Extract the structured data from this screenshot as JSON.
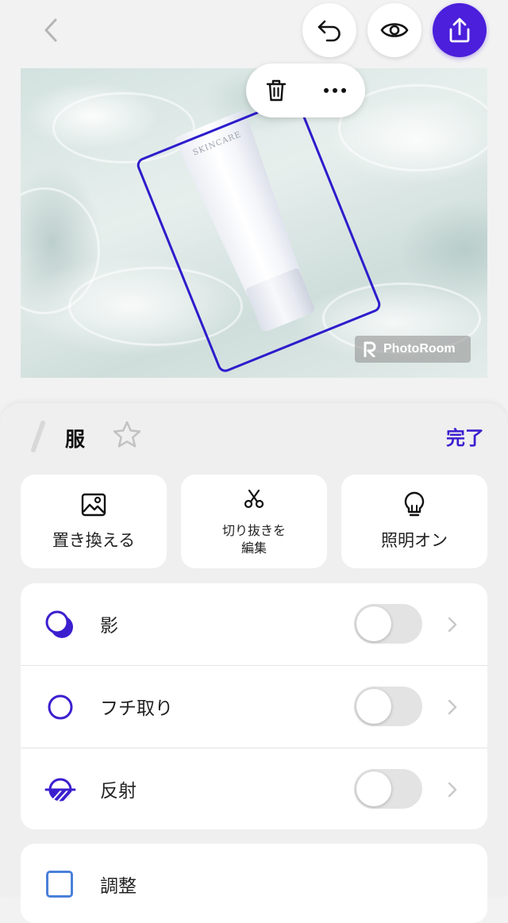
{
  "topbar": {
    "back_icon": "chevron-left-icon",
    "undo_icon": "undo-icon",
    "preview_icon": "eye-icon",
    "share_icon": "share-icon",
    "accent_color": "#4b1fdb"
  },
  "canvas": {
    "product_brand": "SKINCARE",
    "watermark": "PhotoRoom",
    "selection_color": "#2d1ccc",
    "context_menu": {
      "delete_icon": "trash-icon",
      "more_icon": "more-horizontal-icon"
    }
  },
  "sheet": {
    "layer_name": "服",
    "favorite_icon": "star-outline-icon",
    "done_label": "完了",
    "done_color": "#3b1fcf",
    "actions": [
      {
        "label": "置き換える",
        "icon": "image-icon"
      },
      {
        "label": "切り抜きを\n編集",
        "icon": "scissors-icon"
      },
      {
        "label": "照明オン",
        "icon": "lightbulb-icon"
      }
    ],
    "options": [
      {
        "label": "影",
        "icon": "shadow-icon",
        "enabled": false
      },
      {
        "label": "フチ取り",
        "icon": "outline-icon",
        "enabled": false
      },
      {
        "label": "反射",
        "icon": "reflection-icon",
        "enabled": false
      }
    ],
    "next_option": {
      "label": "調整",
      "icon": "adjust-icon"
    }
  }
}
